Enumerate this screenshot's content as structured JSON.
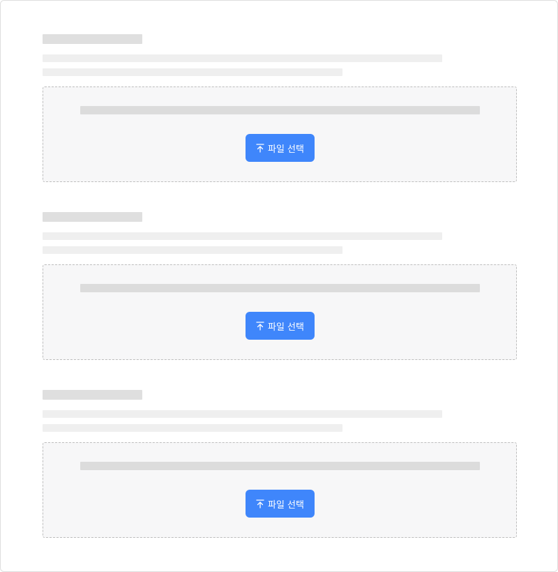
{
  "sections": [
    {
      "upload_button_label": "파일 선택",
      "upload_icon": "upload-arrow-icon"
    },
    {
      "upload_button_label": "파일 선택",
      "upload_icon": "upload-arrow-icon"
    },
    {
      "upload_button_label": "파일 선택",
      "upload_icon": "upload-arrow-icon"
    }
  ],
  "colors": {
    "button_bg": "#3f86fb",
    "button_text": "#ffffff",
    "skeleton_dark": "#dfdfdf",
    "skeleton_light": "#efefef",
    "dropzone_bg": "#f7f7f8",
    "dropzone_border": "#bdbdbd"
  }
}
